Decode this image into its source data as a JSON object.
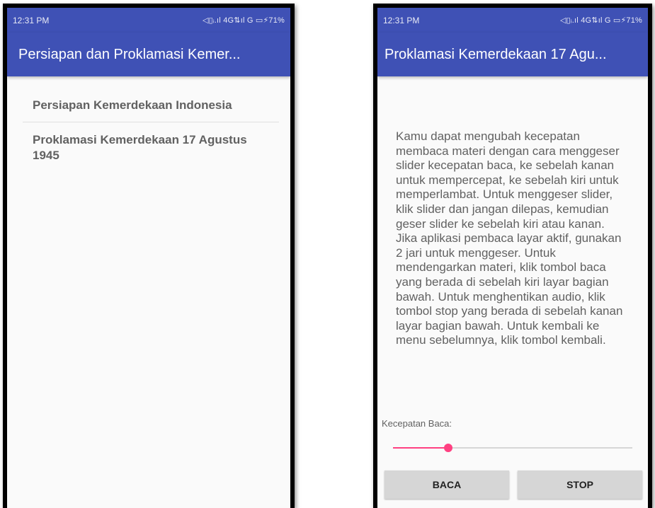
{
  "left_phone": {
    "status": {
      "time": "12:31 PM",
      "icons": "◁▯ᵢ.ıl 4G⇅ıl G ▭⚡71%"
    },
    "appbar": {
      "title": "Persiapan dan Proklamasi Kemer..."
    },
    "list": [
      {
        "label": "Persiapan Kemerdekaan Indonesia"
      },
      {
        "label": "Proklamasi Kemerdekaan 17 Agustus 1945"
      }
    ]
  },
  "right_phone": {
    "status": {
      "time": "12:31 PM",
      "icons": "◁▯ᵢ.ıl 4G⇅ıl G ▭⚡71%"
    },
    "appbar": {
      "title": "Proklamasi Kemerdekaan 17 Agu..."
    },
    "article": {
      "text": "Kamu dapat mengubah kecepatan membaca materi dengan cara menggeser slider kecepatan baca, ke sebelah kanan untuk mempercepat, ke sebelah kiri untuk memperlambat. Untuk menggeser slider, klik slider dan jangan dilepas, kemudian geser slider ke sebelah kiri atau kanan. Jika aplikasi pembaca layar aktif, gunakan 2 jari untuk menggeser. Untuk mendengarkan materi, klik tombol baca yang berada di sebelah kiri layar bagian bawah. Untuk menghentikan audio, klik tombol stop yang berada di sebelah kanan layar bagian bawah. Untuk kembali ke menu sebelumnya, klik tombol kembali."
    },
    "speed": {
      "label": "Kecepatan Baca:",
      "value": 0.23
    },
    "buttons": {
      "read": "BACA",
      "stop": "STOP"
    }
  },
  "colors": {
    "primary": "#3f51b5",
    "accent": "#ff4081",
    "text_secondary": "#616161",
    "button_bg": "#d6d6d6"
  }
}
